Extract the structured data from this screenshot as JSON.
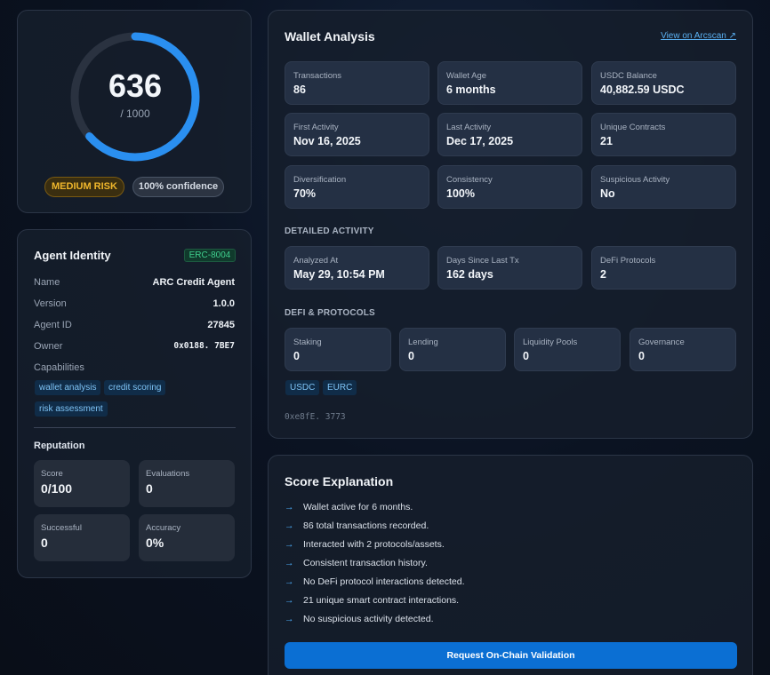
{
  "score": {
    "value": "636",
    "max_label": "/ 1000",
    "fraction": 0.636,
    "risk_label": "MEDIUM RISK",
    "confidence_label": "100% confidence",
    "colors": {
      "arc": "#2a8ff0",
      "track": "#2a3240",
      "risk": "#f0b72c"
    }
  },
  "agent": {
    "title": "Agent Identity",
    "badge": "ERC-8004",
    "fields": [
      {
        "label": "Name",
        "value": "ARC Credit Agent"
      },
      {
        "label": "Version",
        "value": "1.0.0"
      },
      {
        "label": "Agent ID",
        "value": "27845"
      },
      {
        "label": "Owner",
        "value": "0x0188. 7BE7"
      }
    ],
    "capabilities_label": "Capabilities",
    "capabilities": [
      "wallet analysis",
      "credit scoring",
      "risk assessment"
    ],
    "reputation_label": "Reputation",
    "reputation": [
      {
        "label": "Score",
        "value": "0/100"
      },
      {
        "label": "Evaluations",
        "value": "0"
      },
      {
        "label": "Successful",
        "value": "0"
      },
      {
        "label": "Accuracy",
        "value": "0%"
      }
    ]
  },
  "wallet": {
    "title": "Wallet Analysis",
    "link": "View on Arcscan ↗",
    "stats": [
      {
        "label": "Transactions",
        "value": "86"
      },
      {
        "label": "Wallet Age",
        "value": "6 months"
      },
      {
        "label": "USDC Balance",
        "value": "40,882.59 USDC"
      },
      {
        "label": "First Activity",
        "value": "Nov 16, 2025"
      },
      {
        "label": "Last Activity",
        "value": "Dec 17, 2025"
      },
      {
        "label": "Unique Contracts",
        "value": "21"
      },
      {
        "label": "Diversification",
        "value": "70%"
      },
      {
        "label": "Consistency",
        "value": "100%"
      },
      {
        "label": "Suspicious Activity",
        "value": "No"
      }
    ],
    "detailed_label": "DETAILED ACTIVITY",
    "detailed": [
      {
        "label": "Analyzed At",
        "value": "May 29, 10:54 PM"
      },
      {
        "label": "Days Since Last Tx",
        "value": "162 days"
      },
      {
        "label": "DeFi Protocols",
        "value": "2"
      }
    ],
    "defi_label": "DEFI & PROTOCOLS",
    "defi": [
      {
        "label": "Staking",
        "value": "0"
      },
      {
        "label": "Lending",
        "value": "0"
      },
      {
        "label": "Liquidity Pools",
        "value": "0"
      },
      {
        "label": "Governance",
        "value": "0"
      }
    ],
    "assets": [
      "USDC",
      "EURC"
    ],
    "address": "0xe8fE. 3773"
  },
  "explanation": {
    "title": "Score Explanation",
    "arrow": "→",
    "items": [
      "Wallet active for 6 months.",
      "86 total transactions recorded.",
      "Interacted with 2 protocols/assets.",
      "Consistent transaction history.",
      "No DeFi protocol interactions detected.",
      "21 unique smart contract interactions.",
      "No suspicious activity detected."
    ],
    "button": "Request On-Chain Validation"
  }
}
